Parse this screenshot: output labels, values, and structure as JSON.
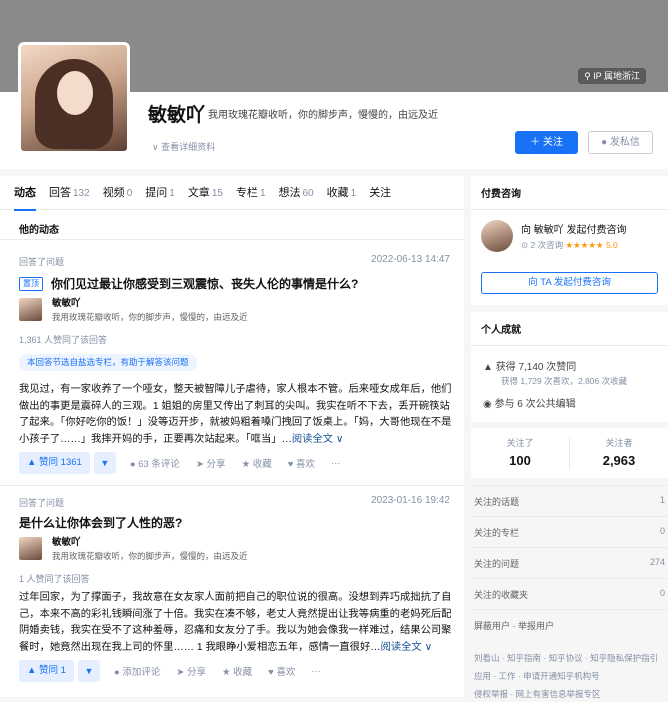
{
  "banner": {
    "ip": "IP 属地浙江"
  },
  "profile": {
    "name": "敏敏吖",
    "bio": "我用玫瑰花瓣收听，你的脚步声，慢慢的，由远及近",
    "detail_link": "查看详细资料",
    "follow_label": "关注",
    "message_label": "发私信"
  },
  "tabs": [
    {
      "label": "动态",
      "count": ""
    },
    {
      "label": "回答",
      "count": "132"
    },
    {
      "label": "视频",
      "count": "0"
    },
    {
      "label": "提问",
      "count": "1"
    },
    {
      "label": "文章",
      "count": "15"
    },
    {
      "label": "专栏",
      "count": "1"
    },
    {
      "label": "想法",
      "count": "60"
    },
    {
      "label": "收藏",
      "count": "1"
    },
    {
      "label": "关注",
      "count": ""
    }
  ],
  "feed": {
    "heading": "他的动态",
    "items": [
      {
        "meta": "回答了问题",
        "date": "2022-06-13 14:47",
        "pin": "置顶",
        "title": "你们见过最让你感受到三观震惊、丧失人伦的事情是什么?",
        "author_name": "敏敏吖",
        "author_bio": "我用玫瑰花瓣收听，你的脚步声，慢慢的，由远及近",
        "votes_line": "1,361 人赞同了该回答",
        "rec_tag": "本回答节选自盐选专栏，有助于解答该问题",
        "excerpt": "我见过，有一家收养了一个哑女，整天被智障儿子虐待，家人根本不管。后来哑女成年后，他们做出的事更是震碎人的三观。1 姐姐的房里又传出了刺耳的尖叫。我实在听不下去，丢开碗筷站了起来。「你好吃你的饭！」没等迈开步，就被妈粗着嗓门拽回了饭桌上。「妈，大哥他现在不是小孩子了……」我摔开妈的手，正要再次站起来。「哐当」…",
        "more": "阅读全文 ∨",
        "vote_label": "▲ 赞同 1361",
        "comment": "63 条评论",
        "share": "分享",
        "collect": "收藏",
        "like": "喜欢",
        "dots": "···"
      },
      {
        "meta": "回答了问题",
        "date": "2023-01-16 19:42",
        "title": "是什么让你体会到了人性的恶?",
        "author_name": "敏敏吖",
        "author_bio": "我用玫瑰花瓣收听，你的脚步声，慢慢的，由远及近",
        "votes_line": "1 人赞同了该回答",
        "excerpt": "过年回家，为了撑面子，我故意在女友家人面前把自己的职位说的很高。没想到弄巧成拙抗了自己，本来不高的彩礼钱瞬间涨了十倍。我实在凑不够，老丈人竟然提出让我等病重的老妈死后配阴婚卖钱，我实在受不了这种羞辱，忍痛和女友分了手。我以为她会像我一样难过，结果公司聚餐时，她竟然出现在我上司的怀里…… 1 我眼睁小爱相恋五年，感情一直很好…",
        "more": "阅读全文 ∨",
        "vote_label": "▲ 赞同 1",
        "comment": "添加评论",
        "share": "分享",
        "collect": "收藏",
        "like": "喜欢",
        "dots": "···"
      }
    ]
  },
  "sidebar": {
    "consult_title": "付费咨询",
    "consult_name": "向 敏敏吖 发起付费咨询",
    "consult_count": "2 次咨询",
    "consult_stars": "★★★★★",
    "consult_score": "5.0",
    "consult_button": "向 TA 发起付费咨询",
    "achieve_title": "个人成就",
    "achieve_likes": "获得 7,140 次赞同",
    "achieve_likes_sub": "获得 1,729 次喜欢，2,806 次收藏",
    "achieve_edit": "参与 6 次公共编辑",
    "following_label": "关注了",
    "following_num": "100",
    "followers_label": "关注者",
    "followers_num": "2,963",
    "stats": [
      {
        "k": "关注的话题",
        "v": "1"
      },
      {
        "k": "关注的专栏",
        "v": "0"
      },
      {
        "k": "关注的问题",
        "v": "274"
      },
      {
        "k": "关注的收藏夹",
        "v": "0"
      }
    ],
    "report": "屏蔽用户 · 举报用户",
    "footer1": "刘看山 · 知乎指南 · 知乎协议 · 知乎隐私保护指引",
    "footer2": "应用 · 工作 · 申请开通知乎机构号",
    "footer3": "侵权举报 · 网上有害信息举报专区"
  }
}
